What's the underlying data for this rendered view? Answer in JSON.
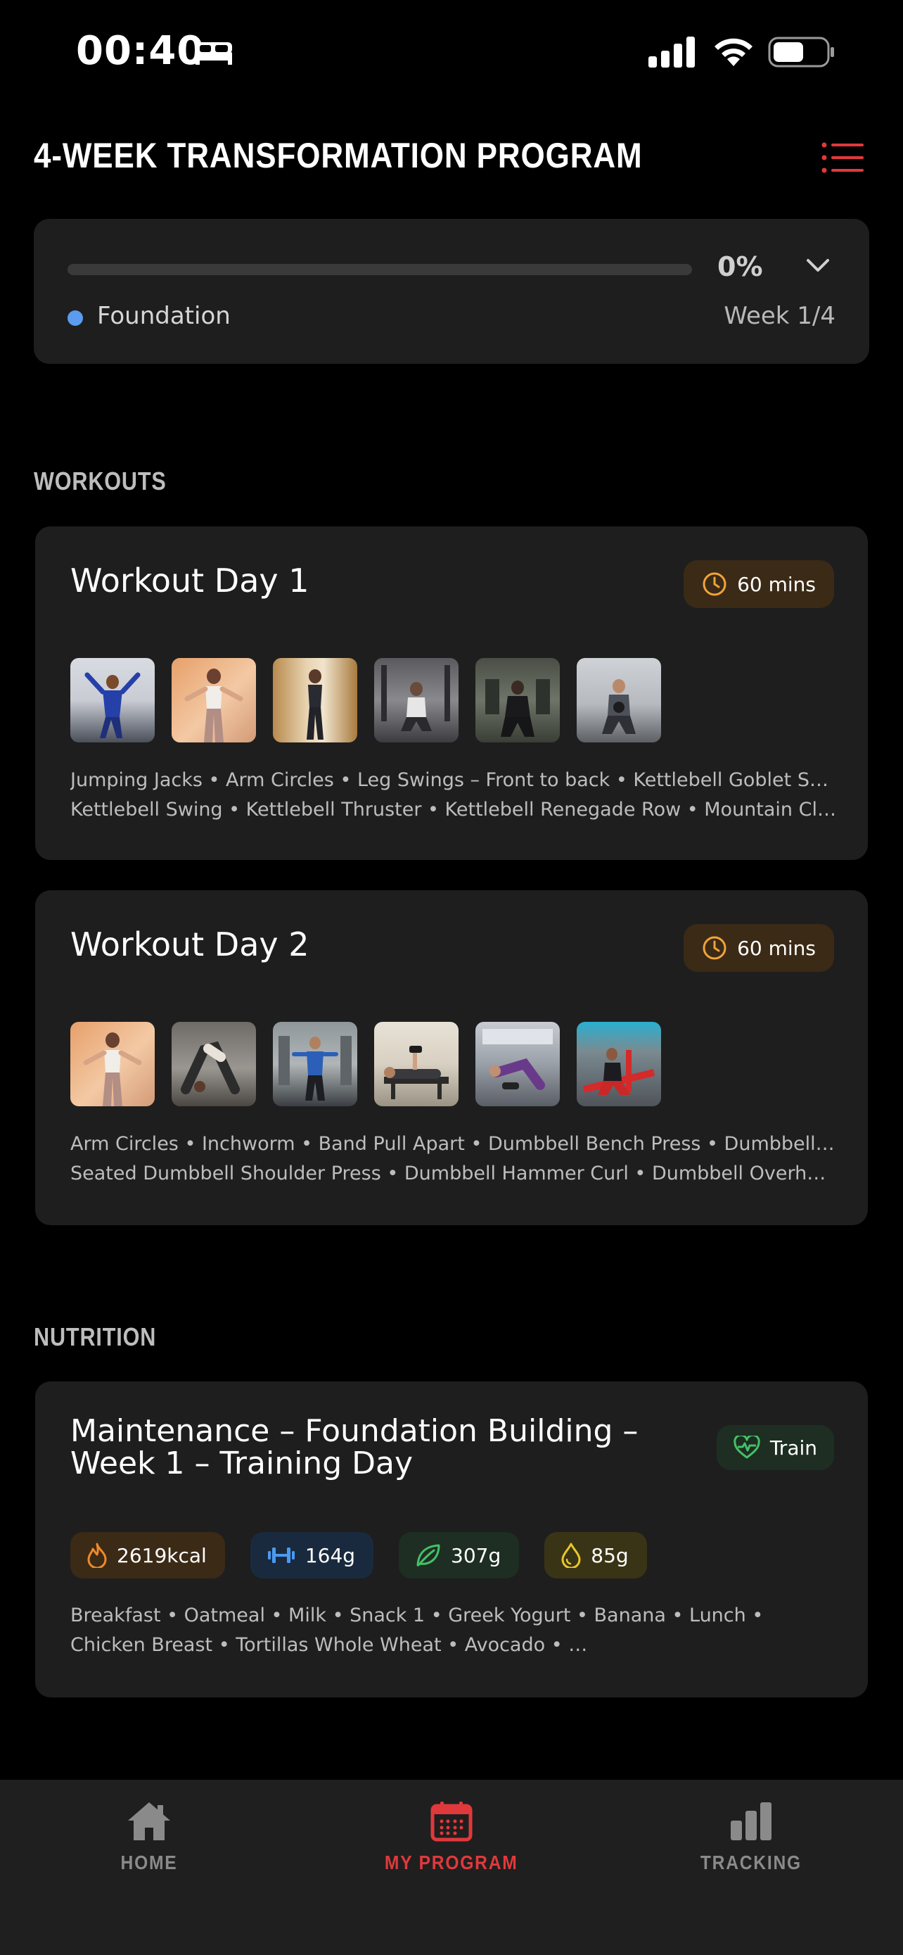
{
  "status_bar": {
    "time": "00:40"
  },
  "header": {
    "title": "4-WEEK TRANSFORMATION PROGRAM"
  },
  "progress": {
    "percent_label": "0%",
    "fraction": 0.0,
    "phase": "Foundation",
    "week": "Week 1/4",
    "colors": {
      "accent": "#5b9bf0"
    }
  },
  "workouts": {
    "heading": "WORKOUTS",
    "items": [
      {
        "title": "Workout Day 1",
        "duration": "60 mins",
        "exercises_line1": "Jumping Jacks • Arm Circles • Leg Swings – Front to back • Kettlebell Goblet Squat •",
        "exercises_line2": "Kettlebell Swing • Kettlebell Thruster • Kettlebell Renegade Row • Mountain Climbers…"
      },
      {
        "title": "Workout Day 2",
        "duration": "60 mins",
        "exercises_line1": "Arm Circles • Inchworm • Band Pull Apart • Dumbbell Bench Press • Dumbbell Row •",
        "exercises_line2": "Seated Dumbbell Shoulder Press • Dumbbell Hammer Curl • Dumbbell Overhead Exte…"
      }
    ]
  },
  "nutrition": {
    "heading": "NUTRITION",
    "title": "Maintenance – Foundation Building – Week 1 – Training Day",
    "badge": "Train",
    "macros": {
      "calories": "2619kcal",
      "protein": "164g",
      "carbs": "307g",
      "fat": "85g"
    },
    "foods": "Breakfast • Oatmeal • Milk • Snack 1 • Greek Yogurt • Banana • Lunch • Chicken Breast • Tortillas Whole Wheat • Avocado • …"
  },
  "nav": {
    "home": "HOME",
    "program": "MY PROGRAM",
    "tracking": "TRACKING",
    "active_color": "#e0393b"
  }
}
